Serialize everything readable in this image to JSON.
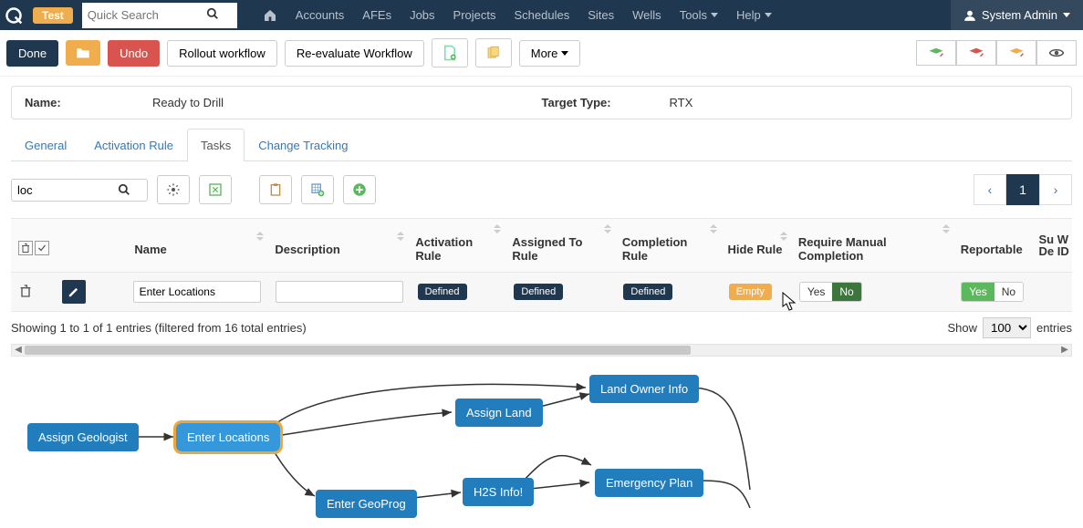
{
  "env_badge": "Test",
  "search_placeholder": "Quick Search",
  "nav": {
    "accounts": "Accounts",
    "afes": "AFEs",
    "jobs": "Jobs",
    "projects": "Projects",
    "schedules": "Schedules",
    "sites": "Sites",
    "wells": "Wells",
    "tools": "Tools",
    "help": "Help"
  },
  "user_label": "System Admin",
  "toolbar": {
    "done": "Done",
    "undo": "Undo",
    "rollout": "Rollout workflow",
    "reeval": "Re-evaluate Workflow",
    "more": "More"
  },
  "info": {
    "name_label": "Name:",
    "name_value": "Ready to Drill",
    "target_label": "Target Type:",
    "target_value": "RTX"
  },
  "tabs": {
    "general": "General",
    "activation": "Activation Rule",
    "tasks": "Tasks",
    "change": "Change Tracking"
  },
  "filter_value": "loc",
  "pager_page": "1",
  "table": {
    "headers": {
      "name": "Name",
      "description": "Description",
      "activation_rule": "Activation Rule",
      "assigned_to_rule": "Assigned To Rule",
      "completion_rule": "Completion Rule",
      "hide_rule": "Hide Rule",
      "require_manual": "Require Manual Completion",
      "reportable": "Reportable",
      "swd": "Su W De ID"
    },
    "row": {
      "name": "Enter Locations",
      "description": "",
      "activation_rule": "Defined",
      "assigned_to_rule": "Defined",
      "completion_rule": "Defined",
      "hide_rule": "Empty",
      "rmc_yes": "Yes",
      "rmc_no": "No",
      "rep_yes": "Yes",
      "rep_no": "No"
    },
    "footer_text": "Showing 1 to 1 of 1 entries (filtered from 16 total entries)",
    "show_label": "Show",
    "show_value": "100",
    "entries_label": "entries"
  },
  "diagram": {
    "n1": "Assign Geologist",
    "n2": "Enter Locations",
    "n3": "Enter GeoProg",
    "n4": "Assign Land",
    "n5": "H2S Info!",
    "n6": "Land Owner Info",
    "n7": "Emergency Plan"
  }
}
